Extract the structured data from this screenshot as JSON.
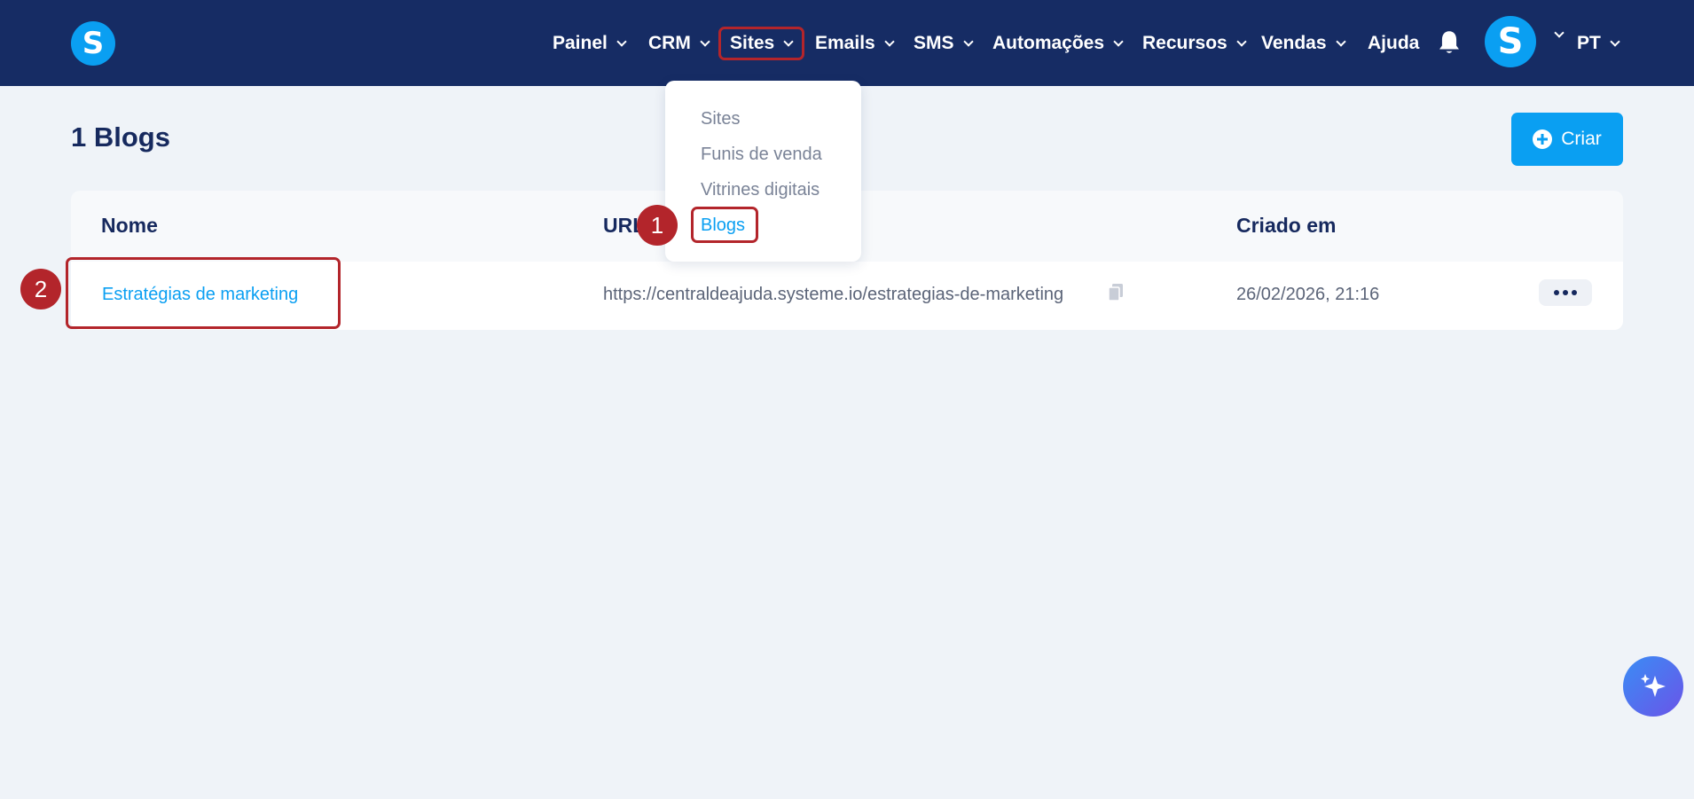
{
  "nav": {
    "logo_letter": "S",
    "items": [
      {
        "label": "Painel",
        "has_dropdown": true
      },
      {
        "label": "CRM",
        "has_dropdown": true
      },
      {
        "label": "Sites",
        "has_dropdown": true,
        "highlighted": true
      },
      {
        "label": "Emails",
        "has_dropdown": true
      },
      {
        "label": "SMS",
        "has_dropdown": true
      },
      {
        "label": "Automações",
        "has_dropdown": true
      },
      {
        "label": "Recursos",
        "has_dropdown": true
      },
      {
        "label": "Vendas",
        "has_dropdown": true
      },
      {
        "label": "Ajuda",
        "has_dropdown": false
      }
    ],
    "avatar_letter": "S",
    "language": "PT",
    "icons": [
      "bell-icon",
      "chevron-down-icon"
    ]
  },
  "sites_menu": {
    "items": [
      {
        "label": "Sites"
      },
      {
        "label": "Funis de venda"
      },
      {
        "label": "Vitrines digitais"
      },
      {
        "label": "Blogs",
        "active": true
      }
    ]
  },
  "page": {
    "title": "1 Blogs",
    "create_label": "Criar"
  },
  "table": {
    "columns": [
      "Nome",
      "URL",
      "Criado em"
    ],
    "rows": [
      {
        "name": "Estratégias de marketing",
        "url": "https://centraldeajuda.systeme.io/estrategias-de-marketing",
        "created": "26/02/2026, 21:16"
      }
    ]
  },
  "annotations": {
    "step1": "1",
    "step2": "2"
  },
  "colors": {
    "nav_bg": "#162c64",
    "accent": "#0a9ff2",
    "highlight": "#b3252b",
    "page_bg": "#eff3f8"
  }
}
